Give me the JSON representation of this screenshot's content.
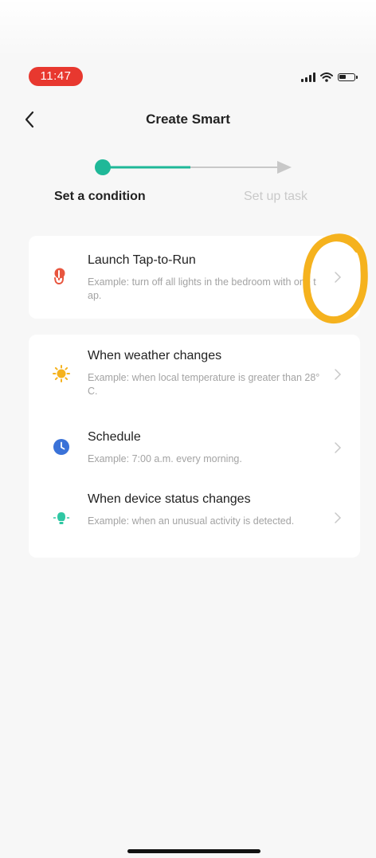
{
  "status_bar": {
    "time": "11:47",
    "time_bg": "#e8382f"
  },
  "nav": {
    "title": "Create Smart",
    "back_icon": "chevron-left-icon"
  },
  "progress": {
    "steps": [
      {
        "label": "Set a condition",
        "active": true
      },
      {
        "label": "Set up task",
        "active": false
      }
    ],
    "fraction": 0.5,
    "accent_color": "#1fb898"
  },
  "conditions": {
    "featured": {
      "title": "Launch Tap-to-Run",
      "desc": "Example: turn off all lights in the bedroom with one tap.",
      "icon": "tap-hand-icon",
      "icon_color": "#e8563f"
    },
    "items": [
      {
        "title": "When weather changes",
        "desc": "Example: when local temperature is greater than 28°C.",
        "icon": "sun-icon",
        "icon_color": "#f5b21e"
      },
      {
        "title": "Schedule",
        "desc": "Example: 7:00 a.m. every morning.",
        "icon": "clock-icon",
        "icon_color": "#3a72d8"
      },
      {
        "title": "When device status changes",
        "desc": "Example: when an unusual activity is detected.",
        "icon": "bulb-icon",
        "icon_color": "#2fc7a3"
      }
    ]
  },
  "annotation": {
    "icon": "circle-annotation-icon",
    "color": "#f5b21e"
  }
}
